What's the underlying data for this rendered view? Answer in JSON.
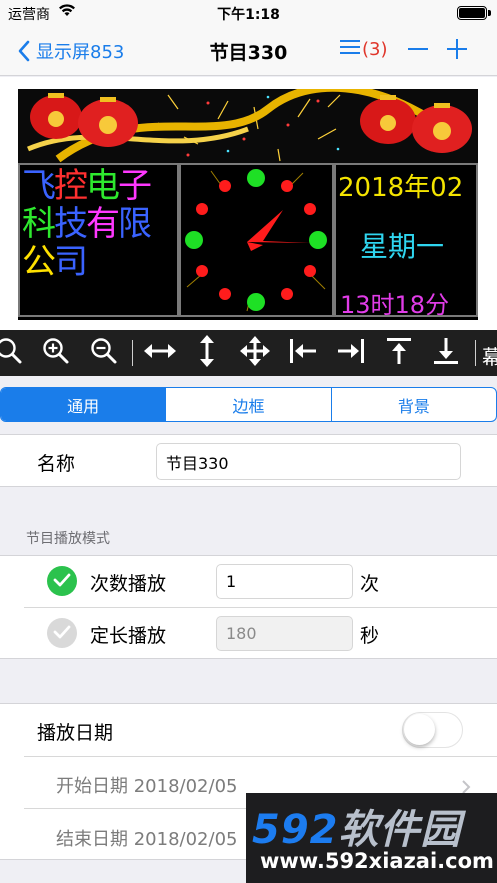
{
  "status_bar": {
    "carrier": "运营商",
    "time": "下午1:18"
  },
  "nav": {
    "back_label": "显示屏853",
    "title": "节目330",
    "count_label": "(3)"
  },
  "preview": {
    "company_chars": [
      {
        "text": "飞",
        "color": "#3a63ff"
      },
      {
        "text": "控",
        "color": "#ff3030"
      },
      {
        "text": "电",
        "color": "#2ee92e"
      },
      {
        "text": "子",
        "color": "#ff38ff"
      },
      {
        "text": "科",
        "color": "#2ee92e"
      },
      {
        "text": "技",
        "color": "#3a63ff"
      },
      {
        "text": "有",
        "color": "#ff38ff"
      },
      {
        "text": "限",
        "color": "#3a63ff"
      },
      {
        "text": "公",
        "color": "#ffe100"
      },
      {
        "text": "司",
        "color": "#3a63ff"
      }
    ],
    "date_text": "2018年02",
    "week_text": "星期一",
    "hour_text": "13时18分"
  },
  "toolbar": {
    "icons": [
      "zoom-fit-icon",
      "zoom-in-icon",
      "zoom-out-icon",
      "expand-horizontal-icon",
      "expand-vertical-icon",
      "move-icon",
      "align-left-icon",
      "align-right-icon",
      "align-top-icon",
      "align-bottom-icon"
    ],
    "overflow_text": "幕"
  },
  "tabs": [
    {
      "label": "通用",
      "active": true
    },
    {
      "label": "边框",
      "active": false
    },
    {
      "label": "背景",
      "active": false
    }
  ],
  "name_row": {
    "label": "名称",
    "value": "节目330"
  },
  "play_mode": {
    "header": "节目播放模式",
    "count_row": {
      "label": "次数播放",
      "value": "1",
      "unit": "次",
      "checked": true
    },
    "duration_row": {
      "label": "定长播放",
      "value": "",
      "placeholder": "180",
      "unit": "秒",
      "checked": false
    }
  },
  "date_group": {
    "toggle_label": "播放日期",
    "toggle_on": false,
    "start_label": "开始日期",
    "start_value": "2018/02/05",
    "end_label": "结束日期",
    "end_value": "2018/02/05"
  },
  "watermark": {
    "digits": "592",
    "brand": "软件园",
    "url": "www.592xiazai.com"
  },
  "colors": {
    "accent": "#1a7dea",
    "badge": "#e0362b",
    "check_on": "#2bc24d",
    "check_off": "#d9d9d9"
  }
}
